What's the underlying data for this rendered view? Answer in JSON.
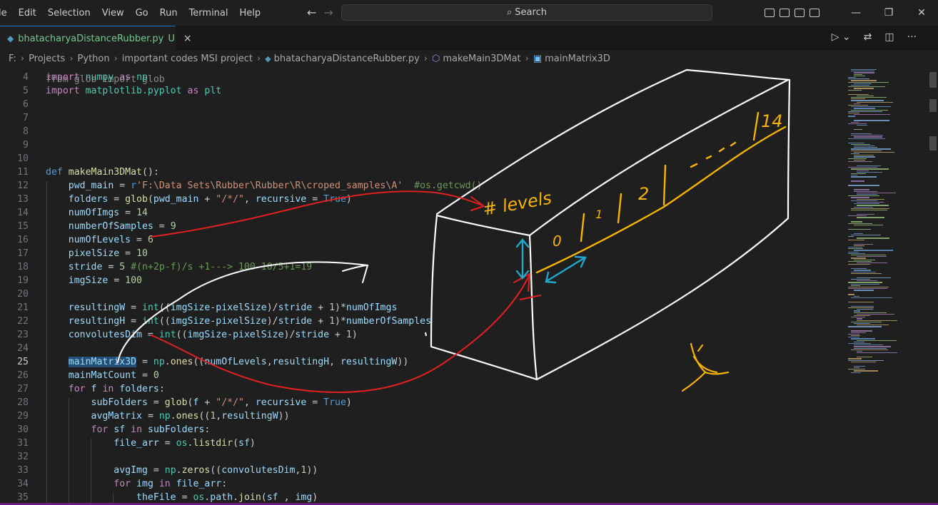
{
  "menu": [
    "le",
    "Edit",
    "Selection",
    "View",
    "Go",
    "Run",
    "Terminal",
    "Help"
  ],
  "search": {
    "label": "Search"
  },
  "tab": {
    "filename": "bhatacharyaDistanceRubber.py",
    "status": "U",
    "close": "×"
  },
  "breadcrumbs": [
    "F:",
    "Projects",
    "Python",
    "important codes MSI project",
    "bhatacharyaDistanceRubber.py",
    "makeMain3DMat",
    "mainMatrix3D"
  ],
  "code_lines": [
    {
      "n": "4",
      "html": "<span class=\"kw\">import</span> <span class=\"cls\">numpy</span> <span class=\"kw\">as</span> <span class=\"cls\">np</span>"
    },
    {
      "n": "5",
      "html": "<span class=\"kw\">import</span> <span class=\"cls\">matplotlib.pyplot</span> <span class=\"kw\">as</span> <span class=\"cls\">plt</span>"
    },
    {
      "n": "6",
      "html": ""
    },
    {
      "n": "7",
      "html": ""
    },
    {
      "n": "8",
      "html": ""
    },
    {
      "n": "9",
      "html": ""
    },
    {
      "n": "10",
      "html": ""
    },
    {
      "n": "11",
      "html": "<span class=\"kwb\">def</span> <span class=\"fn\">makeMain3DMat</span>():"
    },
    {
      "n": "12",
      "html": "    <span class=\"var\">pwd_main</span> = <span class=\"kwb\">r</span><span class=\"str\">'F:\\Data Sets\\Rubber\\Rubber\\R\\croped_samples\\A'</span>  <span class=\"cm\">#os.getcwd()</span>"
    },
    {
      "n": "13",
      "html": "    <span class=\"var\">folders</span> = <span class=\"fn\">glob</span>(<span class=\"var\">pwd_main</span> + <span class=\"str\">\"/*/\"</span>, <span class=\"var\">recursive</span> = <span class=\"kwb\">True</span>)"
    },
    {
      "n": "14",
      "html": "    <span class=\"var\">numOfImgs</span> = <span class=\"num\">14</span>"
    },
    {
      "n": "15",
      "html": "    <span class=\"var\">numberOfSamples</span> = <span class=\"num\">9</span>"
    },
    {
      "n": "16",
      "html": "    <span class=\"var\">numOfLevels</span> = <span class=\"num\">6</span>"
    },
    {
      "n": "17",
      "html": "    <span class=\"var\">pixelSize</span> = <span class=\"num\">10</span>"
    },
    {
      "n": "18",
      "html": "    <span class=\"var\">stride</span> = <span class=\"num\">5</span> <span class=\"cm\">#(n+2p-f)/s +1---&gt; 100-10/5+1=19</span>"
    },
    {
      "n": "19",
      "html": "    <span class=\"var\">imgSize</span> = <span class=\"num\">100</span>"
    },
    {
      "n": "20",
      "html": ""
    },
    {
      "n": "21",
      "html": "    <span class=\"var\">resultingW</span> = <span class=\"cls\">int</span>((<span class=\"var\">imgSize</span>-<span class=\"var\">pixelSize</span>)/<span class=\"var\">stride</span> + <span class=\"num\">1</span>)*<span class=\"var\">numOfImgs</span>"
    },
    {
      "n": "22",
      "html": "    <span class=\"var\">resultingH</span> = <span class=\"cls\">int</span>((<span class=\"var\">imgSize</span>-<span class=\"var\">pixelSize</span>)/<span class=\"var\">stride</span> + <span class=\"num\">1</span>)*<span class=\"var\">numberOfSamples</span>"
    },
    {
      "n": "23",
      "html": "    <span class=\"var\">convolutesDim</span> = <span class=\"cls\">int</span>((<span class=\"var\">imgSize</span>-<span class=\"var\">pixelSize</span>)/<span class=\"var\">stride</span> + <span class=\"num\">1</span>)"
    },
    {
      "n": "24",
      "html": ""
    },
    {
      "n": "25",
      "html": "    <span class=\"var hl\">mainMatrix3D</span> = <span class=\"cls\">np</span>.<span class=\"fn\">ones</span>((<span class=\"var\">numOfLevels</span>,<span class=\"var\">resultingH</span>, <span class=\"var\">resultingW</span>))",
      "current": true
    },
    {
      "n": "26",
      "html": "    <span class=\"var\">mainMatCount</span> = <span class=\"num\">0</span>"
    },
    {
      "n": "27",
      "html": "    <span class=\"kw\">for</span> <span class=\"var\">f</span> <span class=\"kw\">in</span> <span class=\"var\">folders</span>:"
    },
    {
      "n": "28",
      "html": "        <span class=\"var\">subFolders</span> = <span class=\"fn\">glob</span>(<span class=\"var\">f</span> + <span class=\"str\">\"/*/\"</span>, <span class=\"var\">recursive</span> = <span class=\"kwb\">True</span>)"
    },
    {
      "n": "29",
      "html": "        <span class=\"var\">avgMatrix</span> = <span class=\"cls\">np</span>.<span class=\"fn\">ones</span>((<span class=\"num\">1</span>,<span class=\"var\">resultingW</span>))"
    },
    {
      "n": "30",
      "html": "        <span class=\"kw\">for</span> <span class=\"var\">sf</span> <span class=\"kw\">in</span> <span class=\"var\">subFolders</span>:"
    },
    {
      "n": "31",
      "html": "            <span class=\"var\">file_arr</span> = <span class=\"cls\">os</span>.<span class=\"fn\">listdir</span>(<span class=\"var\">sf</span>)"
    },
    {
      "n": "32",
      "html": ""
    },
    {
      "n": "33",
      "html": "            <span class=\"var\">avgImg</span> = <span class=\"cls\">np</span>.<span class=\"fn\">zeros</span>((<span class=\"var\">convolutesDim</span>,<span class=\"num\">1</span>))"
    },
    {
      "n": "34",
      "html": "            <span class=\"kw\">for</span> <span class=\"var\">img</span> <span class=\"kw\">in</span> <span class=\"var\">file_arr</span>:"
    },
    {
      "n": "35",
      "html": "                <span class=\"var\">theFile</span> = <span class=\"cls\">os</span>.<span class=\"var\">path</span>.<span class=\"fn\">join</span>(<span class=\"var\">sf</span> , <span class=\"var\">img</span>)"
    }
  ],
  "annotations": {
    "levels_label": "# levels",
    "slice_0": "0",
    "slice_1": "1",
    "slice_2": "2",
    "slice_14": "14"
  },
  "colors": {
    "ink_white": "#ffffff",
    "ink_red": "#e02020",
    "ink_yellow": "#f5b400",
    "ink_cyan": "#1fa8c9",
    "accent": "#0078d4"
  }
}
